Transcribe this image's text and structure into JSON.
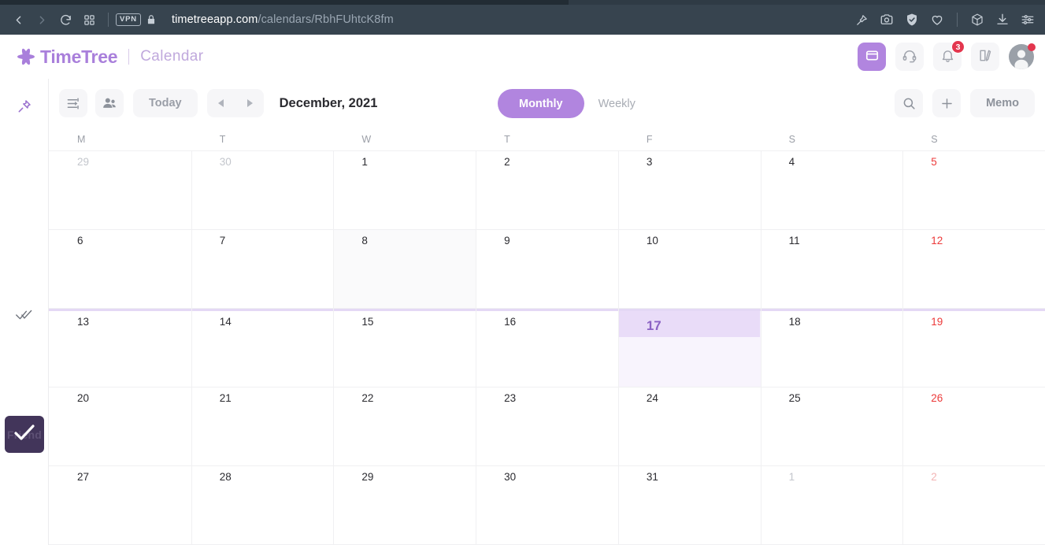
{
  "browser": {
    "url_domain": "timetreeapp.com",
    "url_path": "/calendars/RbhFUhtcK8fm",
    "vpn_label": "VPN",
    "nav_icons": [
      "back-icon",
      "forward-icon",
      "reload-icon",
      "grid-icon",
      "lock-icon"
    ],
    "right_icons": [
      "pin-edit-icon",
      "camera-icon",
      "shield-check-icon",
      "heart-icon",
      "cube-icon",
      "download-icon",
      "settings-sliders-icon"
    ],
    "shield_color": "#5eaaf0"
  },
  "header": {
    "brand": "TimeTree",
    "sub_brand": "Calendar",
    "brand_color": "#a97fdb",
    "accent_color": "#b185df",
    "notification_count": "3",
    "buttons": [
      {
        "name": "calendar-view-button",
        "icon": "calendar-icon",
        "active": true
      },
      {
        "name": "support-button",
        "icon": "headset-icon",
        "active": false
      },
      {
        "name": "notifications-button",
        "icon": "bell-icon",
        "active": false
      },
      {
        "name": "notes-button",
        "icon": "document-pen-icon",
        "active": false
      }
    ],
    "badge_color": "#e3364e"
  },
  "left_rail": {
    "pin_icon": "pin-icon",
    "doublecheck_icon": "double-check-icon",
    "friend_chip_label": "Friend"
  },
  "toolbar": {
    "settings_icon": "filter-sliders-icon",
    "members_icon": "people-icon",
    "today_label": "Today",
    "prev_label": "◀",
    "next_label": "▶",
    "month_title": "December, 2021",
    "monthly_label": "Monthly",
    "weekly_label": "Weekly",
    "search_icon": "search-icon",
    "add_icon": "plus-icon",
    "memo_label": "Memo"
  },
  "calendar": {
    "weekdays": [
      "M",
      "T",
      "W",
      "T",
      "F",
      "S",
      "S"
    ],
    "today": 17,
    "weeks": [
      [
        {
          "n": "29",
          "other": true
        },
        {
          "n": "30",
          "other": true
        },
        {
          "n": "1"
        },
        {
          "n": "2"
        },
        {
          "n": "3"
        },
        {
          "n": "4"
        },
        {
          "n": "5",
          "sunday": true
        }
      ],
      [
        {
          "n": "6"
        },
        {
          "n": "7"
        },
        {
          "n": "8",
          "hover": true
        },
        {
          "n": "9"
        },
        {
          "n": "10"
        },
        {
          "n": "11"
        },
        {
          "n": "12",
          "sunday": true
        }
      ],
      [
        {
          "n": "13"
        },
        {
          "n": "14"
        },
        {
          "n": "15"
        },
        {
          "n": "16"
        },
        {
          "n": "17",
          "today": true
        },
        {
          "n": "18"
        },
        {
          "n": "19",
          "sunday": true
        }
      ],
      [
        {
          "n": "20"
        },
        {
          "n": "21"
        },
        {
          "n": "22"
        },
        {
          "n": "23"
        },
        {
          "n": "24"
        },
        {
          "n": "25"
        },
        {
          "n": "26",
          "sunday": true
        }
      ],
      [
        {
          "n": "27"
        },
        {
          "n": "28"
        },
        {
          "n": "29"
        },
        {
          "n": "30"
        },
        {
          "n": "31"
        },
        {
          "n": "1",
          "other": true
        },
        {
          "n": "2",
          "sunday": true,
          "other": true
        }
      ]
    ],
    "current_week_index": 2,
    "today_band_color": "#e9dcf8",
    "sunday_color": "#ec3a3a"
  }
}
